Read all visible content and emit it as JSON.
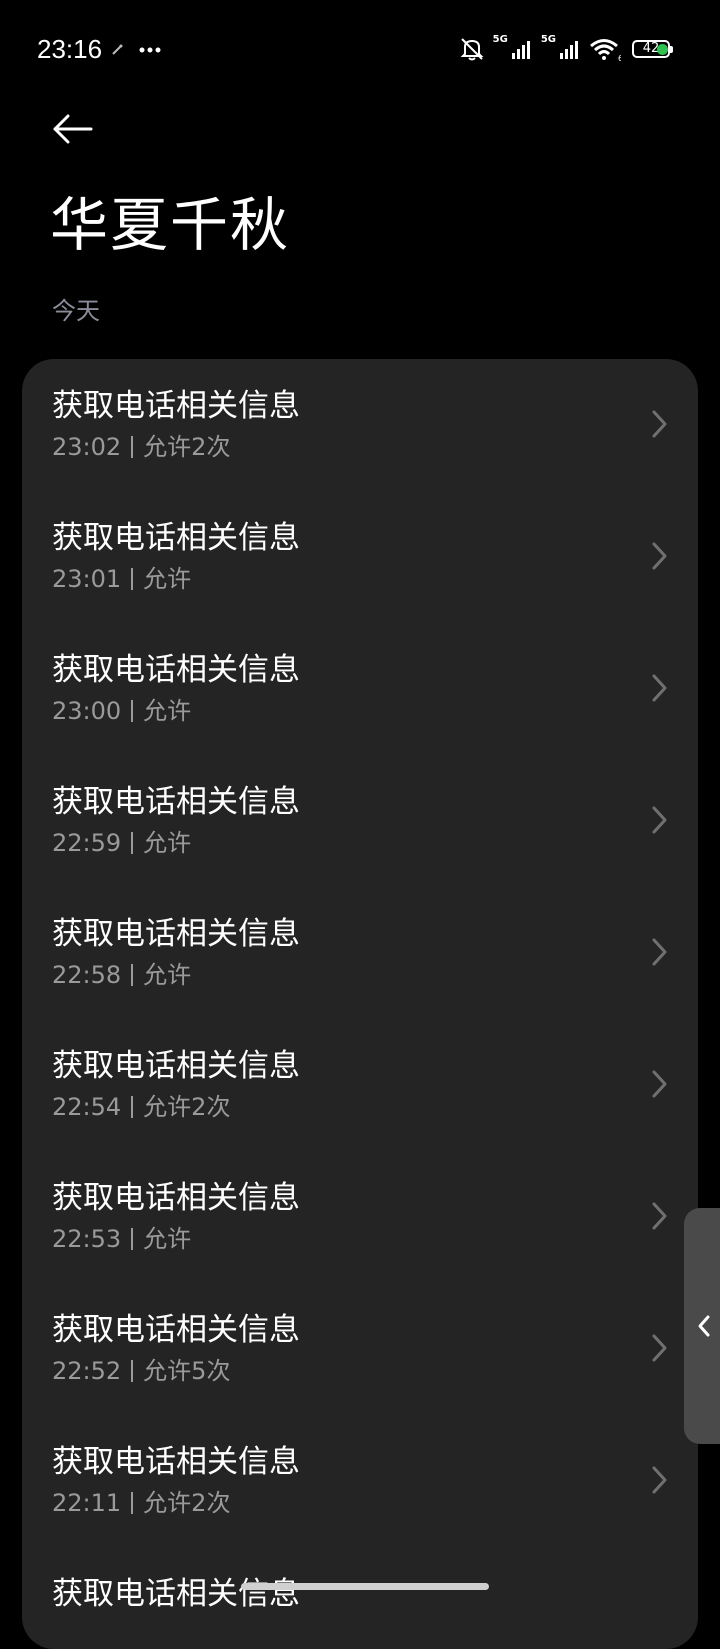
{
  "status_bar": {
    "time": "23:16",
    "network_1": "5G",
    "network_2": "5G",
    "wifi_badge": "6",
    "battery_level": "42",
    "icons": [
      "wand-icon",
      "more-dots-icon",
      "mute-icon",
      "signal-icon",
      "wifi-icon",
      "battery-icon"
    ],
    "indicator_color": "#30c04f"
  },
  "header": {
    "back_icon": "arrow-left-icon",
    "title": "华夏千秋"
  },
  "section": {
    "label": "今天"
  },
  "items": [
    {
      "title": "获取电话相关信息",
      "time": "23:02",
      "status": "允许2次"
    },
    {
      "title": "获取电话相关信息",
      "time": "23:01",
      "status": "允许"
    },
    {
      "title": "获取电话相关信息",
      "time": "23:00",
      "status": "允许"
    },
    {
      "title": "获取电话相关信息",
      "time": "22:59",
      "status": "允许"
    },
    {
      "title": "获取电话相关信息",
      "time": "22:58",
      "status": "允许"
    },
    {
      "title": "获取电话相关信息",
      "time": "22:54",
      "status": "允许2次"
    },
    {
      "title": "获取电话相关信息",
      "time": "22:53",
      "status": "允许"
    },
    {
      "title": "获取电话相关信息",
      "time": "22:52",
      "status": "允许5次"
    },
    {
      "title": "获取电话相关信息",
      "time": "22:11",
      "status": "允许2次"
    },
    {
      "title": "获取电话相关信息",
      "time": "",
      "status": ""
    }
  ],
  "colors": {
    "background": "#000000",
    "card": "#242424",
    "secondary_text": "#9a9a9a",
    "section_text": "#8a8c9a"
  }
}
